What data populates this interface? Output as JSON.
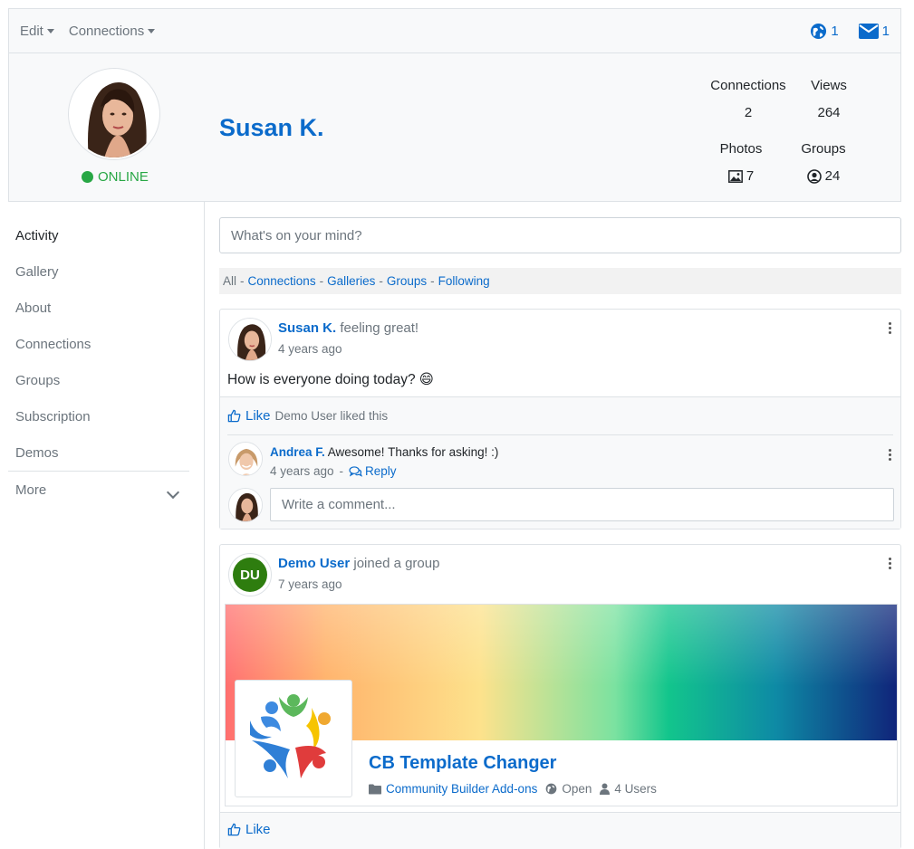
{
  "topbar": {
    "edit_label": "Edit",
    "connections_label": "Connections",
    "globe_count": "1",
    "mail_count": "1"
  },
  "profile": {
    "name": "Susan K.",
    "status": "ONLINE",
    "stats": {
      "connections_label": "Connections",
      "connections_value": "2",
      "views_label": "Views",
      "views_value": "264",
      "photos_label": "Photos",
      "photos_value": "7",
      "groups_label": "Groups",
      "groups_value": "24"
    }
  },
  "sidebar": {
    "items": [
      {
        "label": "Activity"
      },
      {
        "label": "Gallery"
      },
      {
        "label": "About"
      },
      {
        "label": "Connections"
      },
      {
        "label": "Groups"
      },
      {
        "label": "Subscription"
      },
      {
        "label": "Demos"
      }
    ],
    "more_label": "More"
  },
  "composer": {
    "placeholder": "What's on your mind?"
  },
  "filters": {
    "all": "All",
    "items": [
      "Connections",
      "Galleries",
      "Groups",
      "Following"
    ],
    "separator": "-"
  },
  "post1": {
    "author": "Susan K.",
    "action": "feeling great!",
    "time": "4 years ago",
    "body": "How is everyone doing today?",
    "emoji": "😄",
    "like_label": "Like",
    "liked_text": "Demo User liked this",
    "comment": {
      "author": "Andrea F.",
      "text": "Awesome! Thanks for asking! :)",
      "time": "4 years ago",
      "separator": "-",
      "reply_label": "Reply"
    },
    "comment_placeholder": "Write a comment..."
  },
  "post2": {
    "author": "Demo User",
    "initials": "DU",
    "action": "joined a group",
    "time": "7 years ago",
    "group": {
      "title": "CB Template Changer",
      "category": "Community Builder Add-ons",
      "privacy": "Open",
      "users": "4 Users"
    },
    "like_label": "Like"
  },
  "colors": {
    "link": "#0b6bcb",
    "online": "#28a745",
    "avatar_du": "#2e7d0f"
  }
}
